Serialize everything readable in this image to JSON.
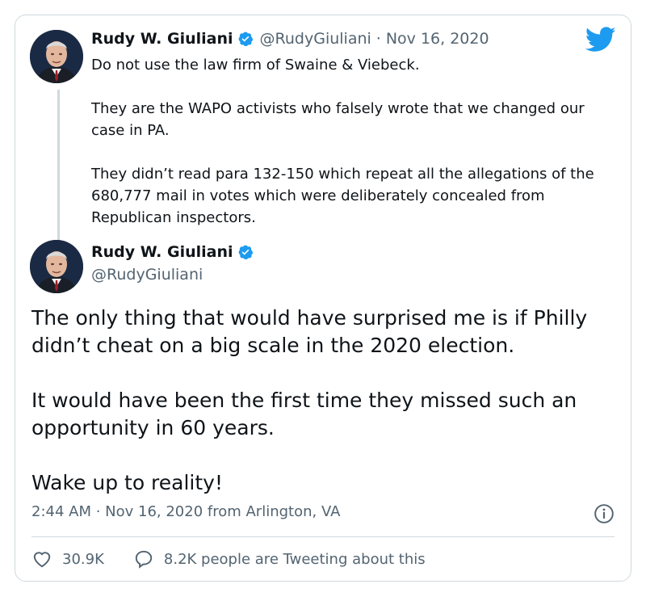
{
  "tweet_reply": {
    "author_name": "Rudy W. Giuliani",
    "author_handle": "@RudyGiuliani",
    "separator": "·",
    "date": "Nov 16, 2020",
    "paragraphs": [
      "Do not use the law firm of Swaine & Viebeck.",
      "They are the WAPO activists who falsely wrote that we changed our case in PA.",
      "They didn’t read para 132-150 which repeat all the allegations of the 680,777 mail in votes which were deliberately concealed from Republican inspectors."
    ]
  },
  "tweet_main": {
    "author_name": "Rudy W. Giuliani",
    "author_handle": "@RudyGiuliani",
    "paragraphs": [
      "The only thing that would have surprised me is if Philly didn’t cheat on a big scale in the 2020 election.",
      "It would have been the first time they missed such an opportunity in 60 years.",
      "Wake up to reality!"
    ],
    "timestamp": "2:44 AM · Nov 16, 2020 from Arlington, VA",
    "likes": "30.9K",
    "conversation": "8.2K people are Tweeting about this"
  },
  "icons": {
    "brand": "twitter-bird-icon",
    "verified": "verified-badge-icon",
    "info": "info-icon",
    "like": "heart-icon",
    "reply": "speech-bubble-icon"
  },
  "colors": {
    "brand_blue": "#1d9bf0",
    "text": "#0f1419",
    "muted": "#536471",
    "border": "#cfd9de"
  }
}
